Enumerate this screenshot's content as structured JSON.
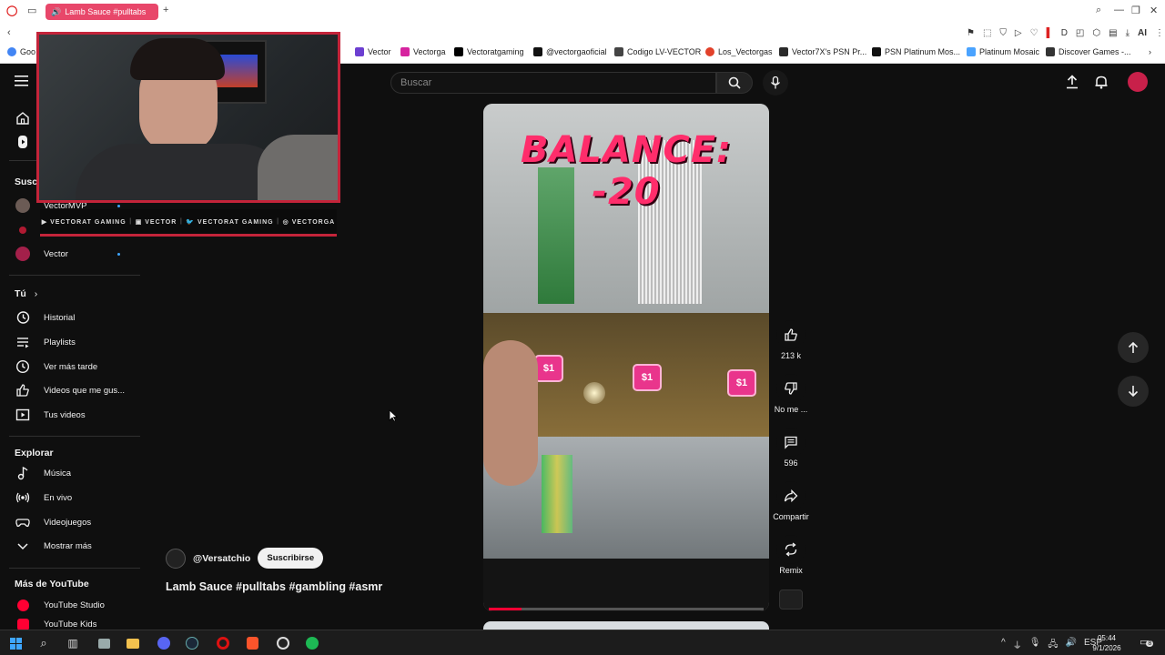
{
  "browser": {
    "tab_title": "Lamb Sauce #pulltabs",
    "address_partial": "",
    "bookmarks": [
      "Vector",
      "Vectorga",
      "Vectoratgaming",
      "@vectorgaoficial",
      "Codigo LV-VECTOR",
      "Los_Vectorgas",
      "Vector7X's PSN Pr...",
      "PSN Platinum Mos...",
      "Platinum Mosaic",
      "Discover Games -..."
    ],
    "bookmark_first": "Goo",
    "ai_label": "AI"
  },
  "youtube": {
    "search_placeholder": "Buscar",
    "sidebar": {
      "subscriptions_header": "Susc",
      "subs": [
        {
          "label": "VectorMVP"
        },
        {
          "label": "Vector"
        }
      ],
      "you_header": "Tú",
      "you_items": [
        "Historial",
        "Playlists",
        "Ver más tarde",
        "Videos que me gus...",
        "Tus videos"
      ],
      "explore_header": "Explorar",
      "explore_items": [
        "Música",
        "En vivo",
        "Videojuegos",
        "Mostrar más"
      ],
      "more_header": "Más de YouTube",
      "more_items": [
        "YouTube Studio",
        "YouTube Kids"
      ]
    },
    "video": {
      "overlay_text": "BALANCE: -20",
      "progress": 0.12
    },
    "actions": {
      "likes": "213 k",
      "dislike": "No me ...",
      "comments": "596",
      "share": "Compartir",
      "remix": "Remix"
    },
    "channel": {
      "handle": "@Versatchio",
      "subscribe": "Suscribirse"
    },
    "title": "Lamb Sauce #pulltabs #gambling #asmr"
  },
  "stream_overlay": {
    "socials": [
      "VECTORAT GAMING",
      "VECTOR",
      "VECTORAT GAMING",
      "VECTORGA"
    ]
  },
  "taskbar": {
    "lang": "ESP",
    "time": "05:44",
    "date": "9/1/2026",
    "notifications": "8"
  },
  "colors": {
    "yt_bg": "#0f0f0f",
    "accent_red": "#ff0033",
    "tab_pink": "#e8476a",
    "overlay_pink": "#ff2d6b",
    "cam_border": "#c4243a"
  }
}
